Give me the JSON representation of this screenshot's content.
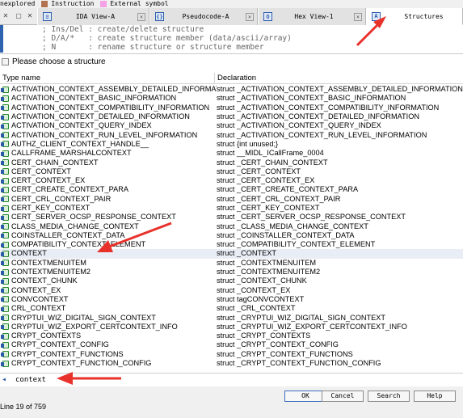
{
  "legend": {
    "items": [
      {
        "label": "nexplored",
        "color": "#a8a8a8"
      },
      {
        "label": "Instruction",
        "color": "#b27251"
      },
      {
        "label": "External symbol",
        "color": "#f5a3e6"
      }
    ]
  },
  "tabs": [
    {
      "label": "IDA View-A",
      "icon": "ida-view-icon",
      "active": false
    },
    {
      "label": "Pseudocode-A",
      "icon": "pseudocode-icon",
      "active": false
    },
    {
      "label": "Hex View-1",
      "icon": "hex-view-icon",
      "active": false
    },
    {
      "label": "Structures",
      "icon": "structures-icon",
      "active": true
    }
  ],
  "comments": [
    "; Ins/Del : create/delete structure",
    "; D/A/*   : create structure member (data/ascii/array)",
    "; N       : rename structure or structure member"
  ],
  "dialog": {
    "title": "Please choose a structure",
    "columns": [
      "Type name",
      "Declaration"
    ],
    "rows": [
      {
        "name": "ACTIVATION_CONTEXT_ASSEMBLY_DETAILED_INFORMATI...",
        "decl": "struct _ACTIVATION_CONTEXT_ASSEMBLY_DETAILED_INFORMATION"
      },
      {
        "name": "ACTIVATION_CONTEXT_BASIC_INFORMATION",
        "decl": "struct _ACTIVATION_CONTEXT_BASIC_INFORMATION"
      },
      {
        "name": "ACTIVATION_CONTEXT_COMPATIBILITY_INFORMATION",
        "decl": "struct _ACTIVATION_CONTEXT_COMPATIBILITY_INFORMATION"
      },
      {
        "name": "ACTIVATION_CONTEXT_DETAILED_INFORMATION",
        "decl": "struct _ACTIVATION_CONTEXT_DETAILED_INFORMATION"
      },
      {
        "name": "ACTIVATION_CONTEXT_QUERY_INDEX",
        "decl": "struct _ACTIVATION_CONTEXT_QUERY_INDEX"
      },
      {
        "name": "ACTIVATION_CONTEXT_RUN_LEVEL_INFORMATION",
        "decl": "struct _ACTIVATION_CONTEXT_RUN_LEVEL_INFORMATION"
      },
      {
        "name": "AUTHZ_CLIENT_CONTEXT_HANDLE__",
        "decl": "struct {int unused;}"
      },
      {
        "name": "CALLFRAME_MARSHALCONTEXT",
        "decl": "struct __MIDL_ICallFrame_0004"
      },
      {
        "name": "CERT_CHAIN_CONTEXT",
        "decl": "struct _CERT_CHAIN_CONTEXT"
      },
      {
        "name": "CERT_CONTEXT",
        "decl": "struct _CERT_CONTEXT"
      },
      {
        "name": "CERT_CONTEXT_EX",
        "decl": "struct _CERT_CONTEXT_EX"
      },
      {
        "name": "CERT_CREATE_CONTEXT_PARA",
        "decl": "struct _CERT_CREATE_CONTEXT_PARA"
      },
      {
        "name": "CERT_CRL_CONTEXT_PAIR",
        "decl": "struct _CERT_CRL_CONTEXT_PAIR"
      },
      {
        "name": "CERT_KEY_CONTEXT",
        "decl": "struct _CERT_KEY_CONTEXT"
      },
      {
        "name": "CERT_SERVER_OCSP_RESPONSE_CONTEXT",
        "decl": "struct _CERT_SERVER_OCSP_RESPONSE_CONTEXT"
      },
      {
        "name": "CLASS_MEDIA_CHANGE_CONTEXT",
        "decl": "struct _CLASS_MEDIA_CHANGE_CONTEXT"
      },
      {
        "name": "COINSTALLER_CONTEXT_DATA",
        "decl": "struct _COINSTALLER_CONTEXT_DATA"
      },
      {
        "name": "COMPATIBILITY_CONTEXT_ELEMENT",
        "decl": "struct _COMPATIBILITY_CONTEXT_ELEMENT"
      },
      {
        "name": "CONTEXT",
        "decl": "struct _CONTEXT",
        "selected": true
      },
      {
        "name": "CONTEXTMENUITEM",
        "decl": "struct _CONTEXTMENUITEM"
      },
      {
        "name": "CONTEXTMENUITEM2",
        "decl": "struct _CONTEXTMENUITEM2"
      },
      {
        "name": "CONTEXT_CHUNK",
        "decl": "struct _CONTEXT_CHUNK"
      },
      {
        "name": "CONTEXT_EX",
        "decl": "struct _CONTEXT_EX"
      },
      {
        "name": "CONVCONTEXT",
        "decl": "struct tagCONVCONTEXT"
      },
      {
        "name": "CRL_CONTEXT",
        "decl": "struct _CRL_CONTEXT"
      },
      {
        "name": "CRYPTUI_WIZ_DIGITAL_SIGN_CONTEXT",
        "decl": "struct _CRYPTUI_WIZ_DIGITAL_SIGN_CONTEXT"
      },
      {
        "name": "CRYPTUI_WIZ_EXPORT_CERTCONTEXT_INFO",
        "decl": "struct _CRYPTUI_WIZ_EXPORT_CERTCONTEXT_INFO"
      },
      {
        "name": "CRYPT_CONTEXTS",
        "decl": "struct _CRYPT_CONTEXTS"
      },
      {
        "name": "CRYPT_CONTEXT_CONFIG",
        "decl": "struct _CRYPT_CONTEXT_CONFIG"
      },
      {
        "name": "CRYPT_CONTEXT_FUNCTIONS",
        "decl": "struct _CRYPT_CONTEXT_FUNCTIONS"
      },
      {
        "name": "CRYPT_CONTEXT_FUNCTION_CONFIG",
        "decl": "struct _CRYPT_CONTEXT_FUNCTION_CONFIG"
      }
    ],
    "search_value": "context",
    "buttons": {
      "ok": "OK",
      "cancel": "Cancel",
      "search": "Search",
      "help": "Help"
    },
    "status": "Line 19 of 759"
  },
  "colors": {
    "arrow": "#e8312a",
    "selection": "#e9eef6",
    "tab_active": "#ffffff"
  }
}
